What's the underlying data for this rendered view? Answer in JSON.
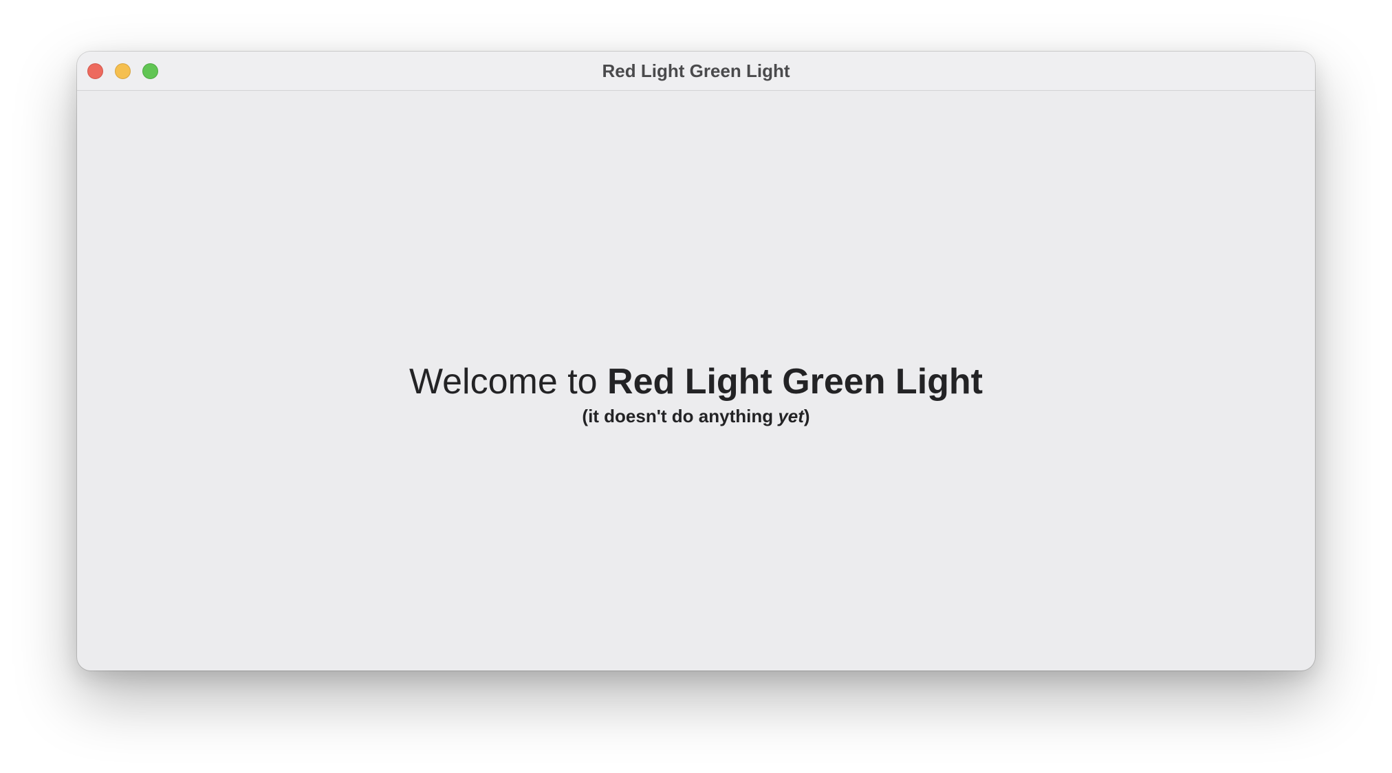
{
  "window": {
    "title": "Red Light Green Light",
    "controls": {
      "close_color": "#ed6a5e",
      "minimize_color": "#f5bf4f",
      "zoom_color": "#61c554"
    }
  },
  "content": {
    "welcome_prefix": "Welcome to ",
    "welcome_app_name": "Red Light Green Light",
    "subtitle_open": "(it doesn't do anything ",
    "subtitle_emphasis": "yet",
    "subtitle_close": ")"
  }
}
